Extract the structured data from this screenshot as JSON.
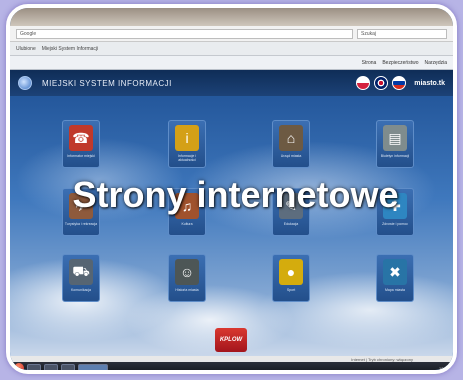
{
  "browser": {
    "address": "Google",
    "search_placeholder": "Szukaj",
    "favorites_label": "Ulubione",
    "page_tab": "Miejski System Informacji",
    "command_items": [
      "Strona",
      "Bezpieczeństwo",
      "Narzędzia"
    ]
  },
  "site": {
    "title": "MIEJSKI SYSTEM INFORMACJI",
    "brand": "miasto.tk",
    "languages": [
      "pl",
      "en",
      "ru"
    ]
  },
  "tiles": [
    {
      "label": "Informator miejski",
      "icon": "info-desk-icon",
      "color": "#c0392b"
    },
    {
      "label": "Informacje i aktualności",
      "icon": "info-icon",
      "color": "#d4a017"
    },
    {
      "label": "Urząd miasta",
      "icon": "building-icon",
      "color": "#6d5a43"
    },
    {
      "label": "Biuletyn informacji",
      "icon": "document-icon",
      "color": "#7f8c8d"
    },
    {
      "label": "Turystyka i rekreacja",
      "icon": "map-icon",
      "color": "#8e5a3c"
    },
    {
      "label": "Kultura",
      "icon": "theatre-icon",
      "color": "#a0522d"
    },
    {
      "label": "Edukacja",
      "icon": "school-icon",
      "color": "#5d6d7e"
    },
    {
      "label": "Zdrowie i pomoc",
      "icon": "health-icon",
      "color": "#2e86c1"
    },
    {
      "label": "Komunikacja",
      "icon": "car-icon",
      "color": "#566573"
    },
    {
      "label": "Historia miasta",
      "icon": "portrait-icon",
      "color": "#4d5656"
    },
    {
      "label": "Sport",
      "icon": "ball-icon",
      "color": "#d4ac0d"
    },
    {
      "label": "Mapa miasta",
      "icon": "tools-icon",
      "color": "#2874a6"
    }
  ],
  "promo_label": "KPLOW",
  "overlay_title": "Strony internetowe",
  "statusbar_text": "Internet | Tryb chroniony: włączony",
  "clock": "10:24"
}
